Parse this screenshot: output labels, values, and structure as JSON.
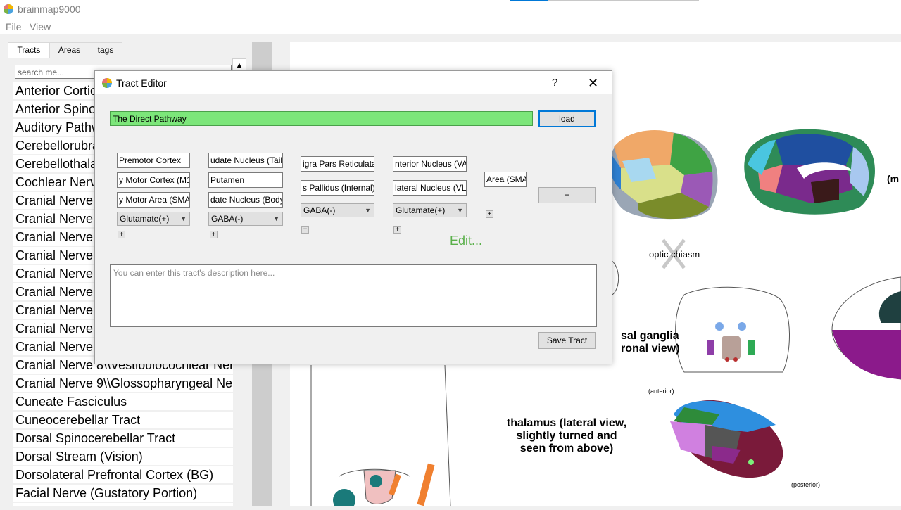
{
  "app": {
    "title": "brainmap9000"
  },
  "menu": {
    "file": "File",
    "view": "View"
  },
  "left_panel": {
    "tabs": [
      {
        "label": "Tracts"
      },
      {
        "label": "Areas"
      },
      {
        "label": "tags"
      }
    ],
    "search_placeholder": "search me...",
    "tracts": [
      "Anterior Cortic",
      "Anterior Spino",
      "Auditory Pathw",
      "Cerebellorubra",
      "Cerebellothala",
      "Cochlear Nerve",
      "Cranial Nerve",
      "Cranial Nerve",
      "Cranial Nerve",
      "Cranial Nerve",
      "Cranial Nerve",
      "Cranial Nerve",
      "Cranial Nerve",
      "Cranial Nerve",
      "Cranial Nerve",
      "Cranial Nerve 8\\\\Vestibulocochlear Ner",
      "Cranial Nerve 9\\\\Glossopharyngeal Ner",
      "Cuneate Fasciculus",
      "Cuneocerebellar Tract",
      "Dorsal Spinocerebellar Tract",
      "Dorsal Stream (Vision)",
      "Dorsolateral Prefrontal Cortex (BG)",
      "Facial Nerve (Gustatory Portion)",
      "Facial Nerve (Motor Portion)"
    ]
  },
  "dialog": {
    "title": "Tract Editor",
    "help": "?",
    "close": "✕",
    "tract_name": "The Direct Pathway",
    "load_label": "load",
    "columns": {
      "c1": {
        "fields": [
          "Premotor Cortex",
          "y Motor Cortex (M1)",
          "y Motor Area (SMA)"
        ],
        "transmitter": "Glutamate(+)"
      },
      "c2": {
        "fields": [
          "udate Nucleus (Tail)",
          "Putamen",
          "date Nucleus (Body)"
        ],
        "transmitter": "GABA(-)"
      },
      "c3": {
        "fields": [
          "igra Pars Reticulata",
          "s Pallidus (Internal)"
        ],
        "transmitter": "GABA(-)"
      },
      "c4": {
        "fields": [
          "nterior Nucleus (VA)",
          "lateral Nucleus (VL)"
        ],
        "transmitter": "Glutamate(+)"
      },
      "c5": {
        "fields": [
          "Area (SMA)"
        ]
      }
    },
    "add_column_label": "+",
    "small_plus": "+",
    "edit_label": "Edit...",
    "description_placeholder": "You can enter this tract's description here...",
    "save_label": "Save Tract"
  },
  "diagrams": {
    "optic_chiasm": "optic chiasm",
    "basal_ganglia_1": "sal ganglia",
    "basal_ganglia_2": "ronal view)",
    "thalamus": "thalamus (lateral view, slightly turned and seen from above)",
    "anterior": "(anterior)",
    "posterior": "(posterior)",
    "m_label": "(m"
  }
}
